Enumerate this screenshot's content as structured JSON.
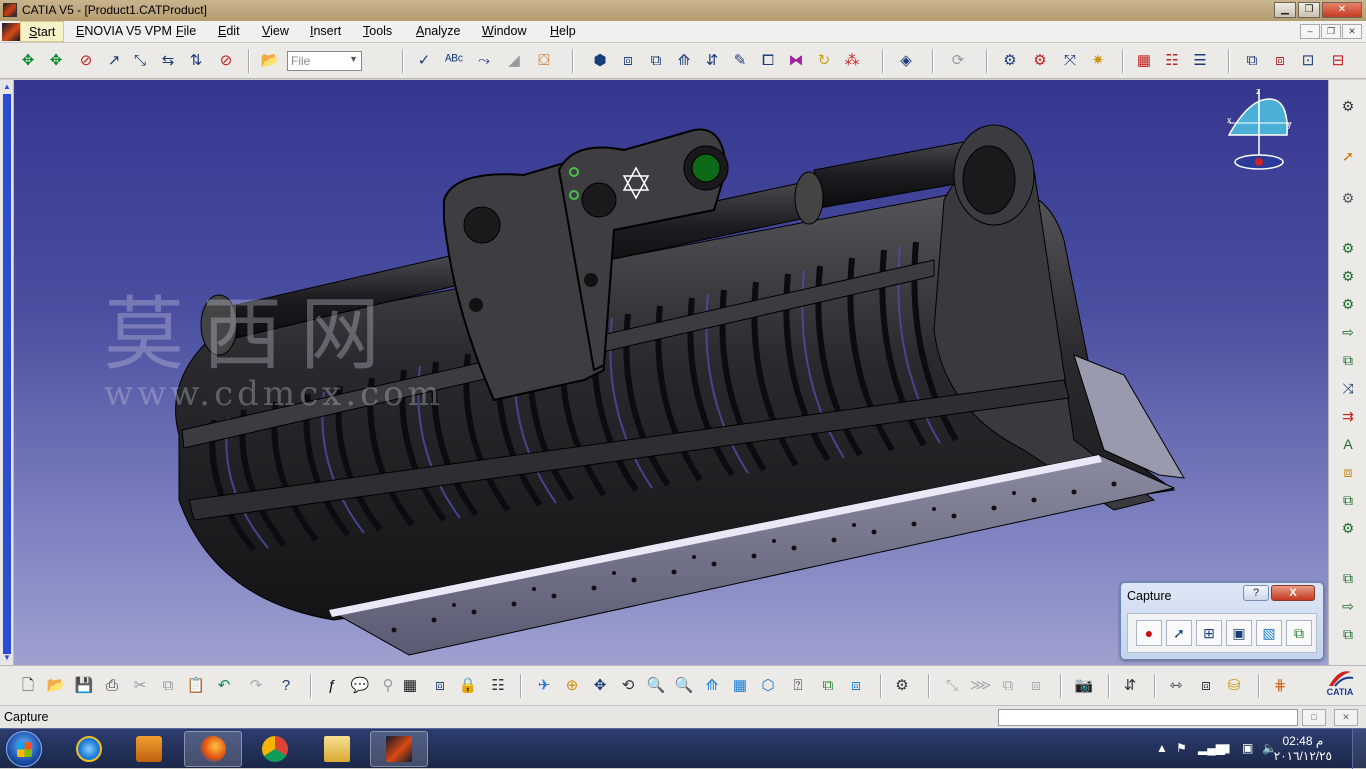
{
  "window": {
    "title": "CATIA V5 - [Product1.CATProduct]"
  },
  "menu": {
    "start": "Start",
    "enovia": "ENOVIA V5 VPM",
    "file": "File",
    "edit": "Edit",
    "view": "View",
    "insert": "Insert",
    "tools": "Tools",
    "analyze": "Analyze",
    "window": "Window",
    "help": "Help"
  },
  "toolbar": {
    "file_combo": "File"
  },
  "watermark": {
    "chinese": "莫西网",
    "url": "www.cdmcx.com"
  },
  "compass": {
    "x": "x",
    "y": "y",
    "z": "z"
  },
  "capture_panel": {
    "title": "Capture",
    "help": "?",
    "close": "X"
  },
  "status": {
    "text": "Capture"
  },
  "branding": {
    "catia_logo": "CATIA"
  },
  "taskbar": {
    "time": "02:48 م",
    "date": "٢٠١٦/١٢/٢٥"
  },
  "colors": {
    "viewport_top": "#35378f",
    "viewport_bottom": "#9ea1cf",
    "model": "#2a2a2e",
    "accent": "#2b4bd4"
  }
}
